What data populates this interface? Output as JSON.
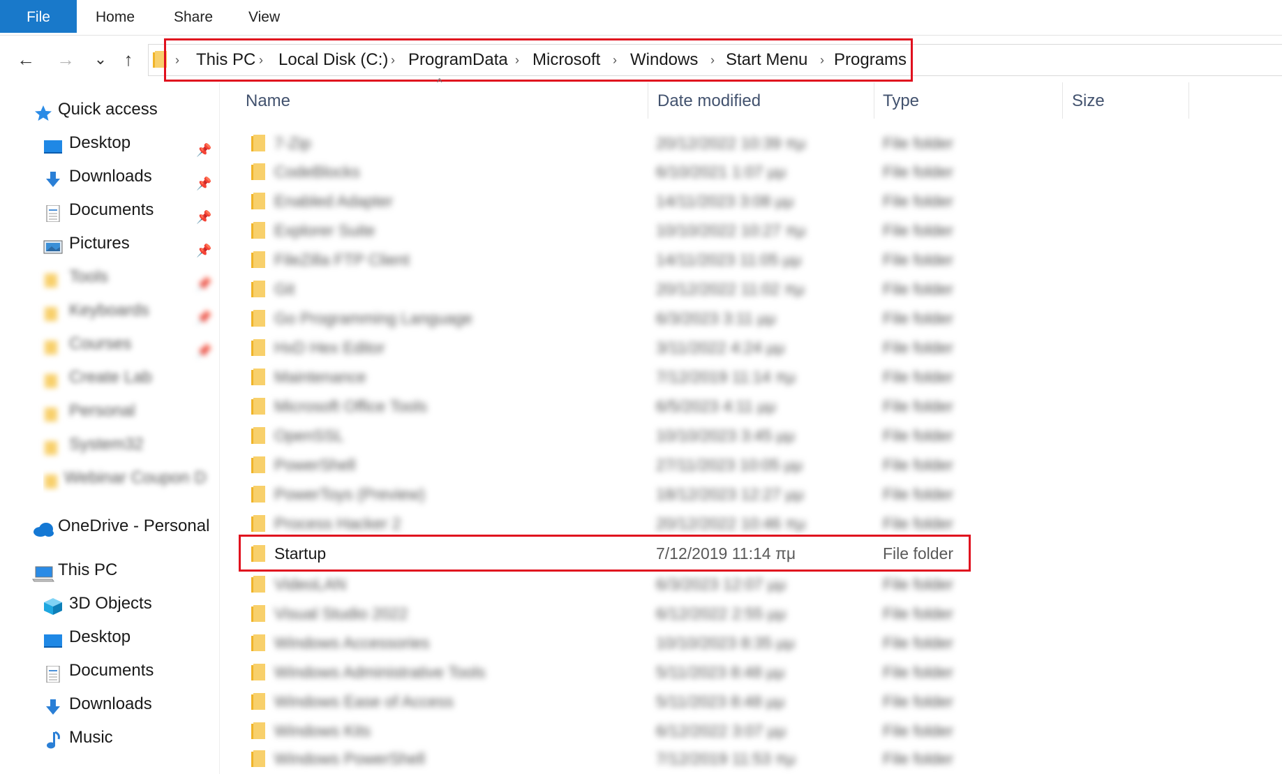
{
  "ribbon": {
    "tabs": [
      "File",
      "Home",
      "Share",
      "View"
    ]
  },
  "nav": {
    "back": "←",
    "forward": "→",
    "recent": "⌄",
    "up": "↑"
  },
  "address": {
    "crumbs": [
      "This PC",
      "Local Disk (C:)",
      "ProgramData",
      "Microsoft",
      "Windows",
      "Start Menu",
      "Programs"
    ],
    "separator": "›"
  },
  "columns": {
    "name": "Name",
    "date": "Date modified",
    "type": "Type",
    "size": "Size"
  },
  "sidebar": {
    "quick_access": "Quick access",
    "pinned": [
      {
        "label": "Desktop",
        "icon": "desktop-icon"
      },
      {
        "label": "Downloads",
        "icon": "downloads-icon"
      },
      {
        "label": "Documents",
        "icon": "documents-icon"
      },
      {
        "label": "Pictures",
        "icon": "pictures-icon"
      }
    ],
    "blurred_items": [
      "Tools",
      "Keyboards",
      "Courses",
      "Create Lab",
      "Personal",
      "System32",
      "Webinar Coupon D"
    ],
    "onedrive": "OneDrive - Personal",
    "this_pc": "This PC",
    "this_pc_items": [
      {
        "label": "3D Objects",
        "icon": "3d-objects-icon"
      },
      {
        "label": "Desktop",
        "icon": "desktop-icon"
      },
      {
        "label": "Documents",
        "icon": "documents-icon"
      },
      {
        "label": "Downloads",
        "icon": "downloads-icon"
      },
      {
        "label": "Music",
        "icon": "music-icon"
      }
    ]
  },
  "files": {
    "rows_before": [
      {
        "name": "7-Zip",
        "date": "20/12/2022 10:39 πμ",
        "type": "File folder"
      },
      {
        "name": "CodeBlocks",
        "date": "6/10/2021 1:07 μμ",
        "type": "File folder"
      },
      {
        "name": "Enabled Adapter",
        "date": "14/11/2023 3:08 μμ",
        "type": "File folder"
      },
      {
        "name": "Explorer Suite",
        "date": "10/10/2022 10:27 πμ",
        "type": "File folder"
      },
      {
        "name": "FileZilla FTP Client",
        "date": "14/11/2023 11:05 μμ",
        "type": "File folder"
      },
      {
        "name": "Git",
        "date": "20/12/2022 11:02 πμ",
        "type": "File folder"
      },
      {
        "name": "Go Programming Language",
        "date": "6/3/2023 3:11 μμ",
        "type": "File folder"
      },
      {
        "name": "HxD Hex Editor",
        "date": "3/11/2022 4:24 μμ",
        "type": "File folder"
      },
      {
        "name": "Maintenance",
        "date": "7/12/2019 11:14 πμ",
        "type": "File folder"
      },
      {
        "name": "Microsoft Office Tools",
        "date": "6/5/2023 4:11 μμ",
        "type": "File folder"
      },
      {
        "name": "OpenSSL",
        "date": "10/10/2023 3:45 μμ",
        "type": "File folder"
      },
      {
        "name": "PowerShell",
        "date": "27/11/2023 10:05 μμ",
        "type": "File folder"
      },
      {
        "name": "PowerToys (Preview)",
        "date": "18/12/2023 12:27 μμ",
        "type": "File folder"
      },
      {
        "name": "Process Hacker 2",
        "date": "20/12/2022 10:46 πμ",
        "type": "File folder"
      }
    ],
    "highlighted_row": {
      "name": "Startup",
      "date": "7/12/2019 11:14 πμ",
      "type": "File folder"
    },
    "rows_after": [
      {
        "name": "VideoLAN",
        "date": "6/3/2023 12:07 μμ",
        "type": "File folder"
      },
      {
        "name": "Visual Studio 2022",
        "date": "6/12/2022 2:55 μμ",
        "type": "File folder"
      },
      {
        "name": "Windows Accessories",
        "date": "10/10/2023 8:35 μμ",
        "type": "File folder"
      },
      {
        "name": "Windows Administrative Tools",
        "date": "5/11/2023 8:48 μμ",
        "type": "File folder"
      },
      {
        "name": "Windows Ease of Access",
        "date": "5/11/2023 8:48 μμ",
        "type": "File folder"
      },
      {
        "name": "Windows Kits",
        "date": "6/12/2022 3:07 μμ",
        "type": "File folder"
      },
      {
        "name": "Windows PowerShell",
        "date": "7/12/2019 11:53 πμ",
        "type": "File folder"
      }
    ]
  },
  "colors": {
    "accent": "#1979ca",
    "highlight": "#e0101e",
    "folder": "#f8d06b"
  }
}
